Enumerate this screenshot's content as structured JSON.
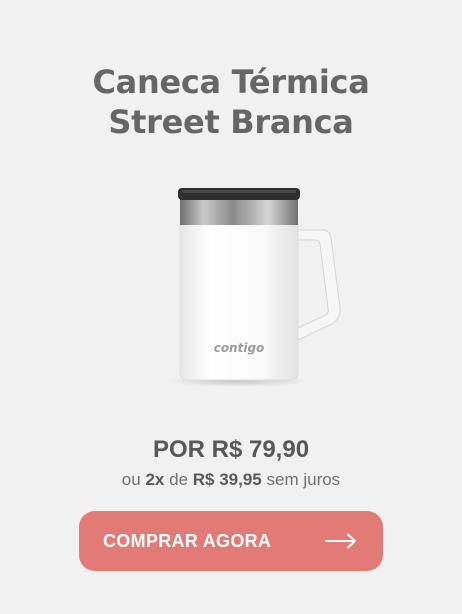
{
  "product": {
    "title_line1": "Caneca Térmica",
    "title_line2": "Street Branca",
    "brand_mark": "contigo"
  },
  "pricing": {
    "price_label": "POR R$ 79,90",
    "installment_prefix": "ou",
    "installment_count": "2x",
    "installment_mid": "de",
    "installment_value": "R$ 39,95",
    "installment_suffix": "sem juros"
  },
  "cta": {
    "label": "COMPRAR AGORA",
    "icon": "arrow-right-icon"
  },
  "colors": {
    "background": "#f1f1f1",
    "title": "#666666",
    "button": "#e27a76",
    "button_text": "#ffffff"
  }
}
